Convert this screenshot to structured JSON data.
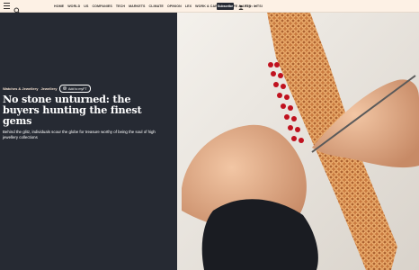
{
  "header": {
    "menu_icon": "hamburger-menu-icon",
    "search_icon": "search-icon",
    "nav_items": [
      "HOME",
      "WORLD",
      "US",
      "COMPANIES",
      "TECH",
      "MARKETS",
      "CLIMATE",
      "OPINION",
      "LEX",
      "WORK & CAREERS",
      "LIFE & ARTS",
      "HTSI"
    ],
    "subscribe_label": "Subscribe",
    "sign_in_label": "Sign In",
    "user_icon": "user-icon"
  },
  "article": {
    "tags": [
      "Watches & Jewellery",
      "Jewellery"
    ],
    "myft_label": "Add to myFT",
    "headline": "No stone unturned: the buyers hunting the finest gems",
    "standfirst": "Behind the glitz, individuals scour the globe for treasure worthy of being the soul of high jewellery collections"
  },
  "colors": {
    "page_bg": "#fdf1e5",
    "panel_bg": "#262a33",
    "tag_color": "#f2dfce",
    "headline_color": "#ffffff"
  }
}
